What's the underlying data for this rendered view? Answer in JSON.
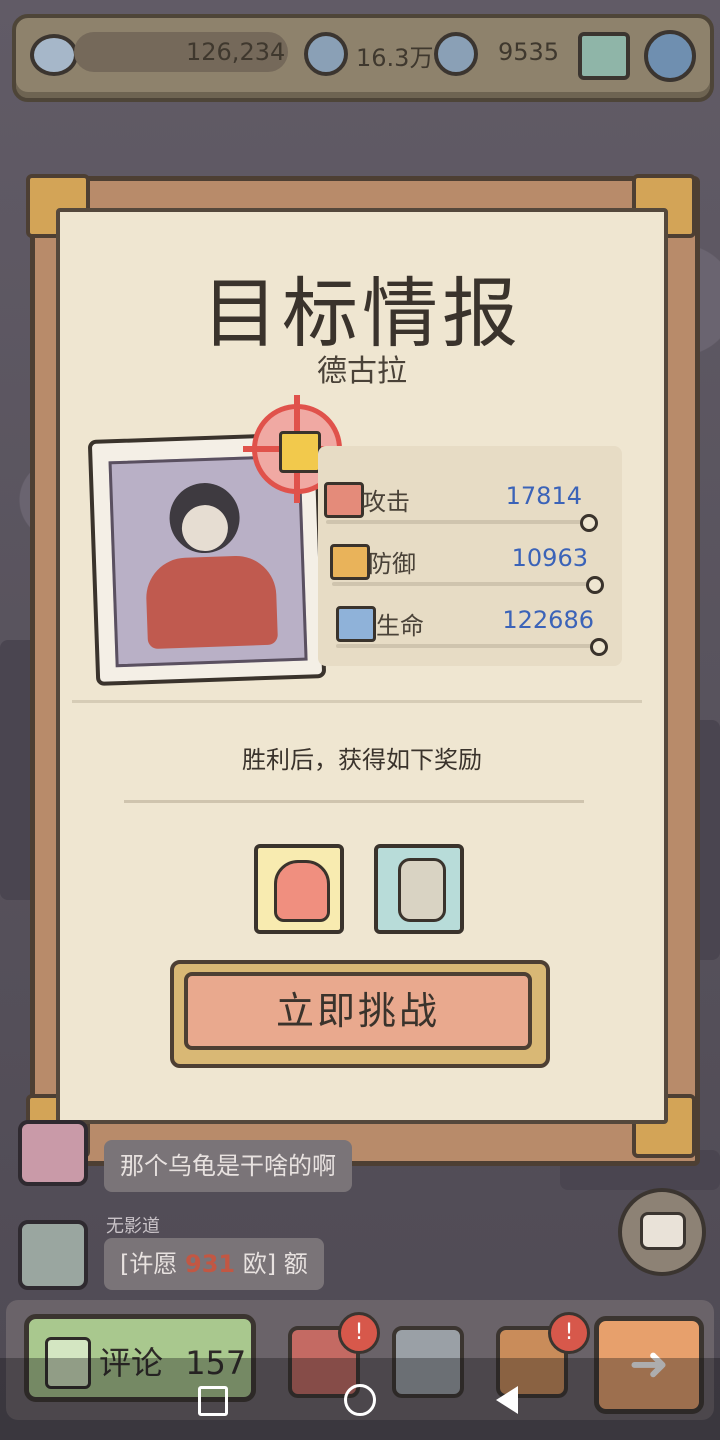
{
  "top_bar": {
    "views": "126,234",
    "chats": "16.3万",
    "messages": "9535",
    "icons": [
      "eye-icon",
      "speech-bubble-icon",
      "chat-bubble-icon",
      "mail-icon",
      "gear-icon"
    ]
  },
  "card": {
    "title": "目标情报",
    "subtitle": "德古拉",
    "stats": [
      {
        "label": "攻击",
        "value": "17814",
        "icon": "attack-icon"
      },
      {
        "label": "防御",
        "value": "10963",
        "icon": "defense-icon"
      },
      {
        "label": "生命",
        "value": "122686",
        "icon": "health-icon"
      }
    ],
    "reward_text": "胜利后，获得如下奖励",
    "rewards": [
      "ghost-reward-icon",
      "mummy-statue-reward-icon"
    ],
    "challenge_button": "立即挑战"
  },
  "chat": {
    "message1": "那个乌龟是干啥的啊",
    "user2_name": "无影道",
    "message2_prefix": "[许愿",
    "message2_number": "931",
    "message2_suffix": "欧] 额"
  },
  "bottom_bar": {
    "comment_label": "评论",
    "comment_count": "157",
    "badge1": "!",
    "badge2": "!"
  },
  "colors": {
    "stat_value": "#3b63b8",
    "challenge_button": "#e9a98e",
    "frame": "#b88b6a",
    "paper": "#efe6d1"
  }
}
